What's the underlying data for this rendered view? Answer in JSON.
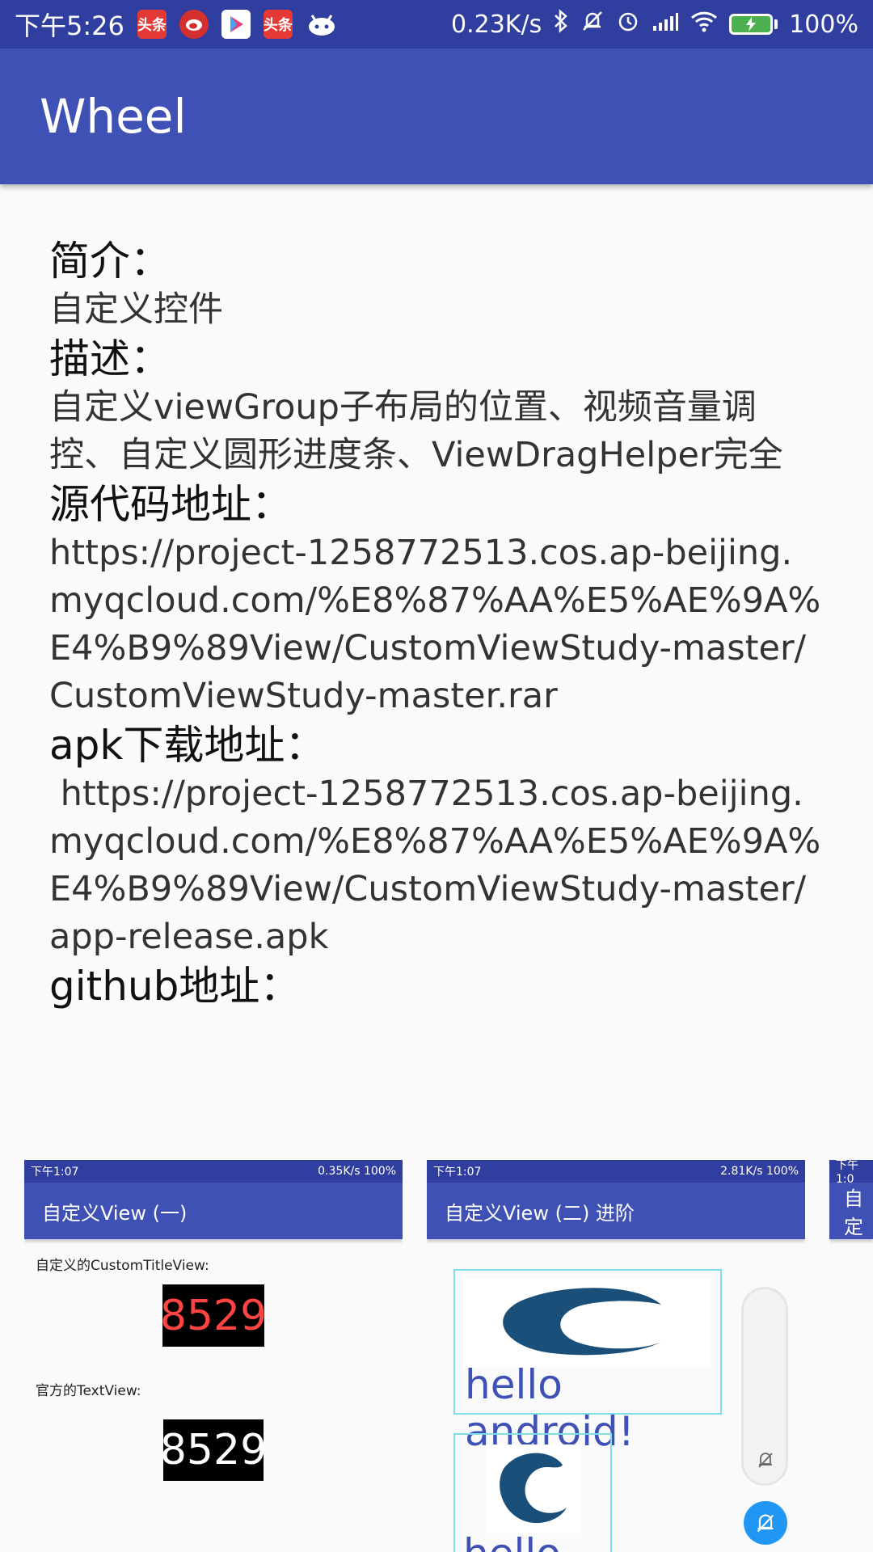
{
  "status_bar": {
    "time": "下午5:26",
    "app_icon_1": "头条",
    "app_icon_4": "头条",
    "speed": "0.23K/s",
    "battery": "100%"
  },
  "toolbar": {
    "title": "Wheel"
  },
  "content": {
    "intro_heading": "简介：",
    "intro_text": "自定义控件",
    "desc_heading": "描述：",
    "desc_text": "自定义viewGroup子布局的位置、视频音量调控、自定义圆形进度条、ViewDragHelper完全",
    "source_heading": "源代码地址：",
    "source_url": "https://project-1258772513.cos.ap-beijing.myqcloud.com/%E8%87%AA%E5%AE%9A%E4%B9%89View/CustomViewStudy-master/CustomViewStudy-master.rar",
    "apk_heading": "apk下载地址：",
    "apk_url": " https://project-1258772513.cos.ap-beijing.myqcloud.com/%E8%87%AA%E5%AE%9A%E4%B9%89View/CustomViewStudy-master/app-release.apk",
    "github_heading": "github地址："
  },
  "gallery": {
    "shot1": {
      "time": "下午1:07",
      "speed": "0.35K/s",
      "battery": "100%",
      "title": "自定义View (一)",
      "label1": "自定义的CustomTitleView:",
      "digits1": "8529",
      "label2": "官方的TextView:",
      "digits2": "8529"
    },
    "shot2": {
      "time": "下午1:07",
      "speed": "2.81K/s",
      "battery": "100%",
      "title": "自定义View (二) 进阶",
      "hello": "hello android!",
      "hello_small": "hello"
    },
    "shot3": {
      "time": "下午1:0",
      "title": "自定"
    }
  },
  "colors": {
    "status_bar": "#303F9F",
    "toolbar": "#3F51B5",
    "digits_red": "#ff4444",
    "fab": "#2196F3"
  }
}
